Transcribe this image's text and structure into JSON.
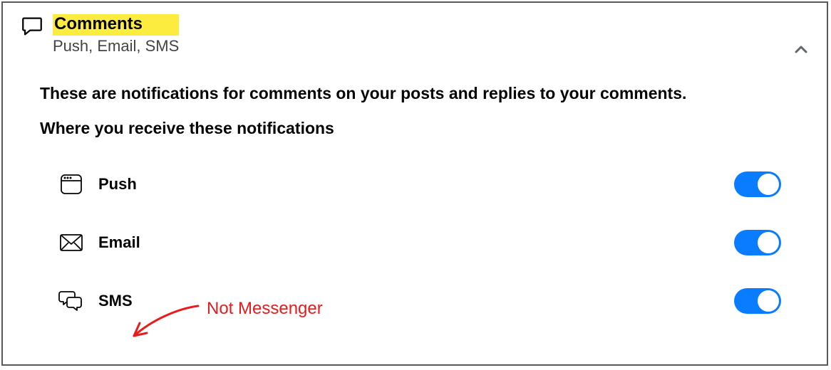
{
  "section": {
    "title": "Comments",
    "subtitle": "Push, Email, SMS",
    "description": "These are notifications for comments on your posts and replies to your comments.",
    "subheading": "Where you receive these notifications"
  },
  "options": {
    "push": {
      "label": "Push",
      "on": true
    },
    "email": {
      "label": "Email",
      "on": true
    },
    "sms": {
      "label": "SMS",
      "on": true
    }
  },
  "annotation": {
    "text": "Not Messenger"
  }
}
